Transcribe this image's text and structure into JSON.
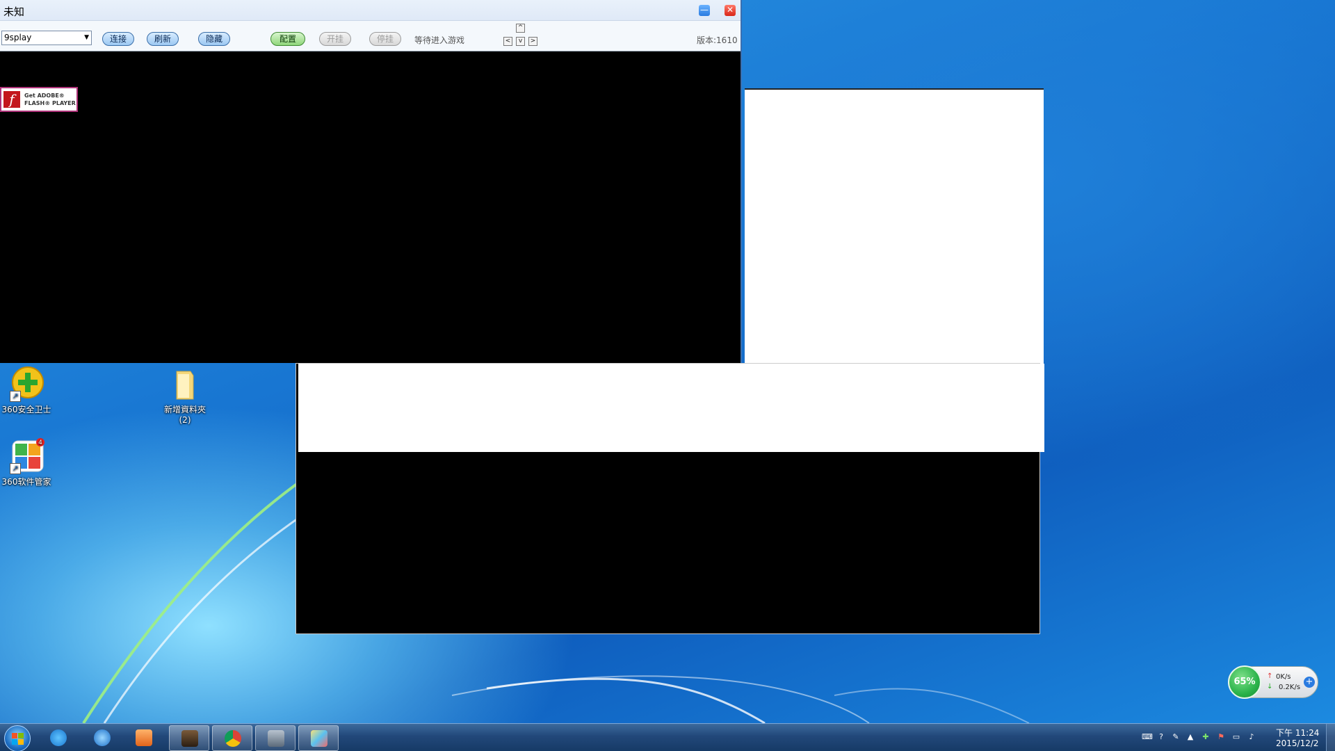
{
  "desktop": {
    "icons": [
      {
        "label": "360安全卫士"
      },
      {
        "label": "新增資料夾\n(2)"
      },
      {
        "label": "360软件管家",
        "badge": "4"
      }
    ]
  },
  "app": {
    "title": "未知",
    "minimize_icon": "minimize-icon",
    "close_icon": "close-icon",
    "combo_value": "9splay",
    "buttons": {
      "connect": "连接",
      "refresh": "刷新",
      "hide": "隐藏",
      "config": "配置",
      "start": "开挂",
      "stop": "停挂"
    },
    "status": "等待进入游戏",
    "arrows": {
      "up": "^",
      "left": "<",
      "down": "v",
      "right": ">"
    },
    "version": "版本:1610",
    "flash": {
      "line1": "Get ADOBE®",
      "line2": "FLASH® PLAYER"
    }
  },
  "net_monitor": {
    "percent": "65%",
    "upload": "0K/s",
    "download": "0.2K/s"
  },
  "taskbar": {
    "clock_time": "下午 11:24",
    "clock_date": "2015/12/2",
    "pinned": [
      "skype-icon",
      "ie-icon",
      "media-player-icon",
      "game-icon",
      "chrome-icon",
      "game2-icon",
      "paint-icon"
    ]
  },
  "colors": {
    "pill_blue": "#9cc8f2",
    "pill_green": "#8fd67a",
    "taskbar": "#22487a"
  }
}
